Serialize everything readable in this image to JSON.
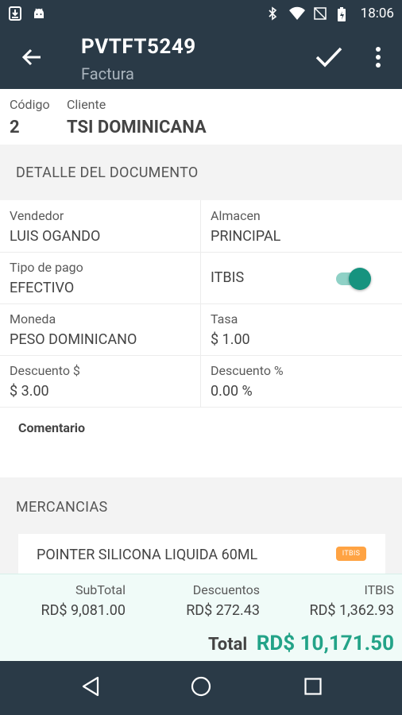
{
  "status_bar": {
    "time": "18:06",
    "icons": [
      "download-icon",
      "android-icon",
      "bluetooth-icon",
      "wifi-icon",
      "no-signal-icon",
      "battery-charging-icon"
    ]
  },
  "app_bar": {
    "title": "PVTFT5249",
    "subtitle": "Factura",
    "icons": [
      "back-arrow-icon",
      "check-icon",
      "more-vert-icon"
    ]
  },
  "header": {
    "codigo_label": "Código",
    "codigo_value": "2",
    "cliente_label": "Cliente",
    "cliente_value": "TSI DOMINICANA"
  },
  "detalle": {
    "section_title": "DETALLE DEL DOCUMENTO",
    "vendedor_label": "Vendedor",
    "vendedor_value": "LUIS OGANDO",
    "almacen_label": "Almacen",
    "almacen_value": "PRINCIPAL",
    "tipo_pago_label": "Tipo de pago",
    "tipo_pago_value": "EFECTIVO",
    "itbis_label": "ITBIS",
    "itbis_enabled": true,
    "moneda_label": "Moneda",
    "moneda_value": "PESO DOMINICANO",
    "tasa_label": "Tasa",
    "tasa_value": "$ 1.00",
    "descuento_amount_label": "Descuento $",
    "descuento_amount_value": "$ 3.00",
    "descuento_pct_label": "Descuento %",
    "descuento_pct_value": "0.00 %",
    "comentario_label": "Comentario"
  },
  "mercancias": {
    "section_title": "MERCANCIAS",
    "items": [
      {
        "name": "POINTER SILICONA LIQUIDA 60ML",
        "badge": "ITBIS"
      }
    ]
  },
  "totals": {
    "subtotal_label": "SubTotal",
    "subtotal_value": "RD$ 9,081.00",
    "descuentos_label": "Descuentos",
    "descuentos_value": "RD$ 272.43",
    "itbis_label": "ITBIS",
    "itbis_value": "RD$ 1,362.93",
    "total_label": "Total",
    "total_value": "RD$ 10,171.50"
  },
  "colors": {
    "primary_dark": "#2a3a47",
    "accent_green": "#23a388",
    "toggle_on": "#16937f",
    "badge_orange": "#ffa343",
    "totals_bg": "#f0fbf8"
  }
}
